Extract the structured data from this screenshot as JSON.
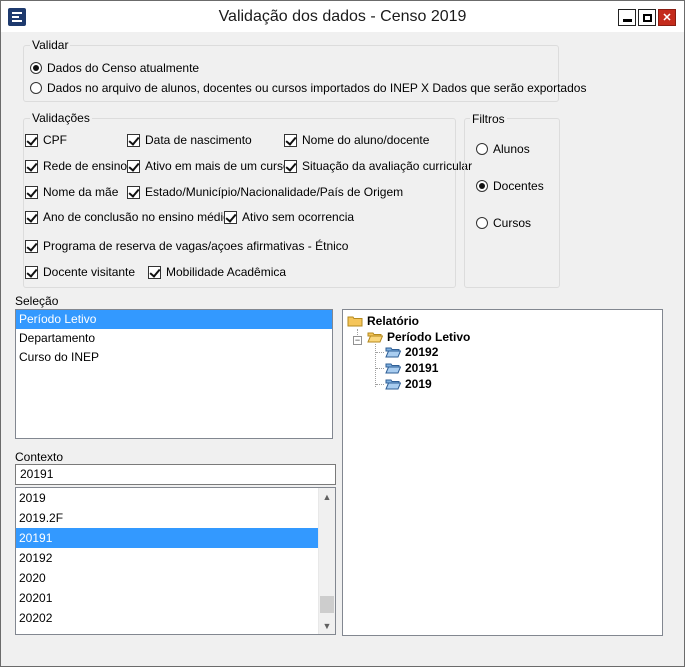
{
  "window": {
    "title": "Validação dos dados - Censo 2019",
    "minimize_label": "",
    "maximize_label": "",
    "close_label": "✕"
  },
  "validar": {
    "label": "Validar",
    "options": [
      {
        "label": "Dados do Censo atualmente",
        "selected": true
      },
      {
        "label": "Dados no arquivo de alunos, docentes ou cursos importados do INEP X Dados que serão exportados",
        "selected": false
      }
    ]
  },
  "validacoes": {
    "label": "Validações",
    "checks": [
      {
        "label": "CPF",
        "checked": true
      },
      {
        "label": "Data de nascimento",
        "checked": true
      },
      {
        "label": "Nome do aluno/docente",
        "checked": true
      },
      {
        "label": "Rede de ensino",
        "checked": true
      },
      {
        "label": "Ativo em mais de um curso",
        "checked": true
      },
      {
        "label": "Situação da avaliação curricular",
        "checked": true
      },
      {
        "label": "Nome da mãe",
        "checked": true
      },
      {
        "label": "Estado/Município/Nacionalidade/País de Origem",
        "checked": true
      },
      {
        "label": "Ano de conclusão no ensino médio",
        "checked": true
      },
      {
        "label": "Ativo sem ocorrencia",
        "checked": true
      },
      {
        "label": "Programa de reserva de vagas/açoes afirmativas - Étnico",
        "checked": true
      },
      {
        "label": "Docente visitante",
        "checked": true
      },
      {
        "label": "Mobilidade Acadêmica",
        "checked": true
      }
    ]
  },
  "filtros": {
    "label": "Filtros",
    "options": [
      {
        "label": "Alunos",
        "selected": false
      },
      {
        "label": "Docentes",
        "selected": true
      },
      {
        "label": "Cursos",
        "selected": false
      }
    ]
  },
  "selecao": {
    "label": "Seleção",
    "items": [
      "Período Letivo",
      "Departamento",
      "Curso do INEP"
    ],
    "selected_index": 0
  },
  "contexto": {
    "label": "Contexto",
    "value": "20191",
    "items": [
      "2019",
      "2019.2F",
      "20191",
      "20192",
      "2020",
      "20201",
      "20202"
    ],
    "selected_index": 2
  },
  "relatorio": {
    "root": "Relatório",
    "child": "Período Letivo",
    "leaves": [
      "20192",
      "20191",
      "2019"
    ],
    "expander": "−"
  },
  "colors": {
    "selection": "#3399ff",
    "title_icon": "#1e3a6e",
    "close_button": "#c42b1c",
    "folder": "#f5c55a"
  }
}
